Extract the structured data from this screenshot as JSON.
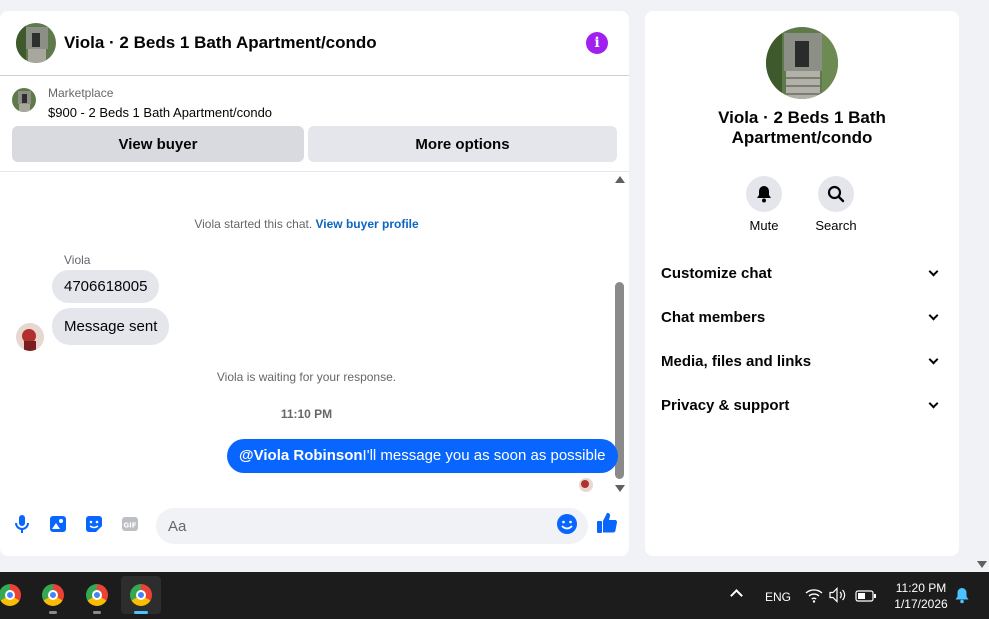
{
  "chat": {
    "title": "Viola · 2 Beds 1 Bath Apartment/condo",
    "listing": {
      "source": "Marketplace",
      "title": "$900 - 2 Beds 1 Bath Apartment/condo"
    },
    "buttons": {
      "view_buyer": "View buyer",
      "more_options": "More options"
    },
    "started_text": "Viola started this chat.",
    "view_profile_link": "View buyer profile",
    "sender_name": "Viola",
    "incoming_messages": [
      "4706618005",
      "Message sent"
    ],
    "waiting_text": "Viola is waiting for your response.",
    "timestamp": "11:10 PM",
    "outgoing_message": {
      "mention": "@Viola Robinson",
      "text": "I'll message you as soon as possible"
    },
    "composer_placeholder": "Aa"
  },
  "info_panel": {
    "name": "Viola · 2 Beds 1 Bath Apartment/condo",
    "actions": [
      {
        "label": "Mute",
        "icon": "bell-icon"
      },
      {
        "label": "Search",
        "icon": "search-icon"
      }
    ],
    "sections": [
      "Customize chat",
      "Chat members",
      "Media, files and links",
      "Privacy & support"
    ]
  },
  "taskbar": {
    "language": "ENG",
    "time": "11:20 PM",
    "date": "1/17/2026"
  },
  "colors": {
    "accent": "#0866ff",
    "info": "#a020f0",
    "link": "#0a66c2"
  }
}
